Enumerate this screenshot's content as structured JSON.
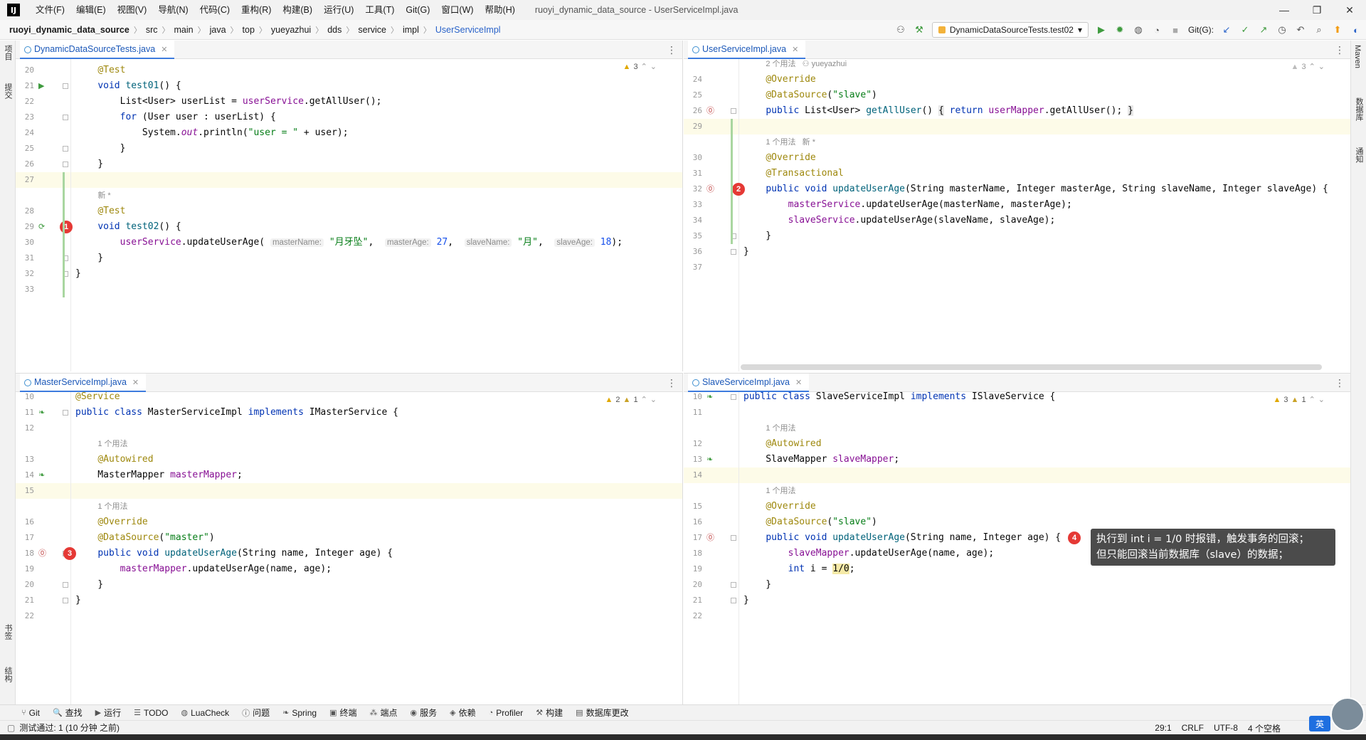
{
  "menubar": {
    "logo": "IJ",
    "items": [
      "文件(F)",
      "编辑(E)",
      "视图(V)",
      "导航(N)",
      "代码(C)",
      "重构(R)",
      "构建(B)",
      "运行(U)",
      "工具(T)",
      "Git(G)",
      "窗口(W)",
      "帮助(H)"
    ],
    "title": "ruoyi_dynamic_data_source - UserServiceImpl.java",
    "win_min": "—",
    "win_max": "❐",
    "win_close": "✕"
  },
  "navbar": {
    "crumbs": [
      "ruoyi_dynamic_data_source",
      "src",
      "main",
      "java",
      "top",
      "yueyazhui",
      "dds",
      "service",
      "impl",
      "UserServiceImpl"
    ],
    "run_config": "DynamicDataSourceTests.test02",
    "git_label": "Git(G):"
  },
  "left_strip": [
    "项目",
    "提交",
    "书签",
    "结构"
  ],
  "right_strip": [
    "Maven",
    "数据库",
    "通知"
  ],
  "panes": {
    "tests": {
      "tab": "DynamicDataSourceTests.java",
      "warnings": "3",
      "badge": "1",
      "lines": [
        {
          "n": "20",
          "html": "    <span class='ann'>@Test</span>"
        },
        {
          "n": "21",
          "html": "    <span class='kw'>void</span> <span class='fn'>test01</span>() {"
        },
        {
          "n": "22",
          "html": "        List&lt;User&gt; userList = <span class='fld'>userService</span>.getAllUser();"
        },
        {
          "n": "23",
          "html": "        <span class='kw'>for</span> (User user : userList) {"
        },
        {
          "n": "24",
          "html": "            System.<span class='fld it'>out</span>.println(<span class='str'>\"user = \"</span> + user);"
        },
        {
          "n": "25",
          "html": "        }"
        },
        {
          "n": "26",
          "html": "    }"
        },
        {
          "n": "27",
          "html": "",
          "hl": true
        },
        {
          "n": "",
          "html": "    <span class='meta'>新 *</span>"
        },
        {
          "n": "28",
          "html": "    <span class='ann'>@Test</span>"
        },
        {
          "n": "29",
          "html": "    <span class='kw'>void</span> <span class='fn'>test02</span>() {"
        },
        {
          "n": "30",
          "html": "        <span class='fld'>userService</span>.updateUserAge( <span class='hint'>masterName:</span> <span class='str'>\"月牙坠\"</span>,  <span class='hint'>masterAge:</span> <span class='num'>27</span>,  <span class='hint'>slaveName:</span> <span class='str'>\"月\"</span>,  <span class='hint'>slaveAge:</span> <span class='num'>18</span>);"
        },
        {
          "n": "31",
          "html": "    }"
        },
        {
          "n": "32",
          "html": "}"
        },
        {
          "n": "33",
          "html": ""
        }
      ]
    },
    "user": {
      "tab": "UserServiceImpl.java",
      "warnings": "3",
      "badge": "2",
      "lines": [
        {
          "n": "",
          "html": "    <span class='meta'>2 个用法   ⚇ yueyazhui</span>"
        },
        {
          "n": "24",
          "html": "    <span class='ann'>@Override</span>"
        },
        {
          "n": "25",
          "html": "    <span class='ann'>@DataSource</span>(<span class='str'>\"slave\"</span>)"
        },
        {
          "n": "26",
          "html": "    <span class='kw'>public</span> List&lt;User&gt; <span class='fn'>getAllUser</span>() <span class='brace-hl'>{</span> <span class='kw'>return</span> <span class='fld'>userMapper</span>.getAllUser(); <span class='brace-hl'>}</span>"
        },
        {
          "n": "29",
          "html": "",
          "hl": true
        },
        {
          "n": "",
          "html": "    <span class='meta'>1 个用法   新 *</span>"
        },
        {
          "n": "30",
          "html": "    <span class='ann'>@Override</span>"
        },
        {
          "n": "31",
          "html": "    <span class='ann'>@Transactional</span>"
        },
        {
          "n": "32",
          "html": "    <span class='kw'>public void</span> <span class='fn'>updateUserAge</span>(String masterName, Integer masterAge, String slaveName, Integer slaveAge) {"
        },
        {
          "n": "33",
          "html": "        <span class='fld'>masterService</span>.updateUserAge(masterName, masterAge);"
        },
        {
          "n": "34",
          "html": "        <span class='fld'>slaveService</span>.updateUserAge(slaveName, slaveAge);"
        },
        {
          "n": "35",
          "html": "    }"
        },
        {
          "n": "36",
          "html": "}"
        },
        {
          "n": "37",
          "html": ""
        }
      ]
    },
    "master": {
      "tab": "MasterServiceImpl.java",
      "warnings": "2",
      "weak": "1",
      "badge": "3",
      "lines": [
        {
          "n": "10",
          "html": "<span class='ann'>@Service</span>"
        },
        {
          "n": "11",
          "html": "<span class='kw'>public class</span> MasterServiceImpl <span class='kw'>implements</span> IMasterService {"
        },
        {
          "n": "12",
          "html": ""
        },
        {
          "n": "",
          "html": "    <span class='meta'>1 个用法</span>"
        },
        {
          "n": "13",
          "html": "    <span class='ann'>@Autowired</span>"
        },
        {
          "n": "14",
          "html": "    MasterMapper <span class='fld'>masterMapper</span>;"
        },
        {
          "n": "15",
          "html": "",
          "hl": true
        },
        {
          "n": "",
          "html": "    <span class='meta'>1 个用法</span>"
        },
        {
          "n": "16",
          "html": "    <span class='ann'>@Override</span>"
        },
        {
          "n": "17",
          "html": "    <span class='ann'>@DataSource</span>(<span class='str'>\"master\"</span>)"
        },
        {
          "n": "18",
          "html": "    <span class='kw'>public void</span> <span class='fn'>updateUserAge</span>(String name, Integer age) {"
        },
        {
          "n": "19",
          "html": "        <span class='fld'>masterMapper</span>.updateUserAge(name, age);"
        },
        {
          "n": "20",
          "html": "    }"
        },
        {
          "n": "21",
          "html": "}"
        },
        {
          "n": "22",
          "html": ""
        }
      ]
    },
    "slave": {
      "tab": "SlaveServiceImpl.java",
      "warnings": "3",
      "weak": "1",
      "badge": "4",
      "lines": [
        {
          "n": "10",
          "html": "<span class='kw'>public class</span> SlaveServiceImpl <span class='kw'>implements</span> ISlaveService {"
        },
        {
          "n": "11",
          "html": ""
        },
        {
          "n": "",
          "html": "    <span class='meta'>1 个用法</span>"
        },
        {
          "n": "12",
          "html": "    <span class='ann'>@Autowired</span>"
        },
        {
          "n": "13",
          "html": "    SlaveMapper <span class='fld'>slaveMapper</span>;"
        },
        {
          "n": "14",
          "html": "",
          "hl": true
        },
        {
          "n": "",
          "html": "    <span class='meta'>1 个用法</span>"
        },
        {
          "n": "15",
          "html": "    <span class='ann'>@Override</span>"
        },
        {
          "n": "16",
          "html": "    <span class='ann'>@DataSource</span>(<span class='str'>\"slave\"</span>)"
        },
        {
          "n": "17",
          "html": "    <span class='kw'>public void</span> <span class='fn'>updateUserAge</span>(String name, Integer age) {"
        },
        {
          "n": "18",
          "html": "        <span class='fld'>slaveMapper</span>.updateUserAge(name, age);"
        },
        {
          "n": "19",
          "html": "        <span class='kw'>int</span> i = <span class='div-hl'>1/0</span>;"
        },
        {
          "n": "20",
          "html": "    }"
        },
        {
          "n": "21",
          "html": "}"
        },
        {
          "n": "22",
          "html": ""
        }
      ]
    }
  },
  "tooltip": {
    "line1": "执行到 int i = 1/0 时报错，触发事务的回滚；",
    "line2": "但只能回滚当前数据库（slave）的数据；"
  },
  "toolwindows": [
    "Git",
    "查找",
    "运行",
    "TODO",
    "LuaCheck",
    "问题",
    "Spring",
    "终端",
    "端点",
    "服务",
    "依赖",
    "Profiler",
    "构建",
    "数据库更改"
  ],
  "toolwindow_icons": [
    "⑂",
    "🔍",
    "▶",
    "☰",
    "◍",
    "ⓘ",
    "❧",
    "▣",
    "⁂",
    "◉",
    "◈",
    "◔",
    "⚒",
    "▤"
  ],
  "status": {
    "message": "测试通过: 1 (10 分钟 之前)",
    "position": "29:1",
    "line_sep": "CRLF",
    "encoding": "UTF-8",
    "indent": "4 个空格",
    "ime": "英"
  }
}
